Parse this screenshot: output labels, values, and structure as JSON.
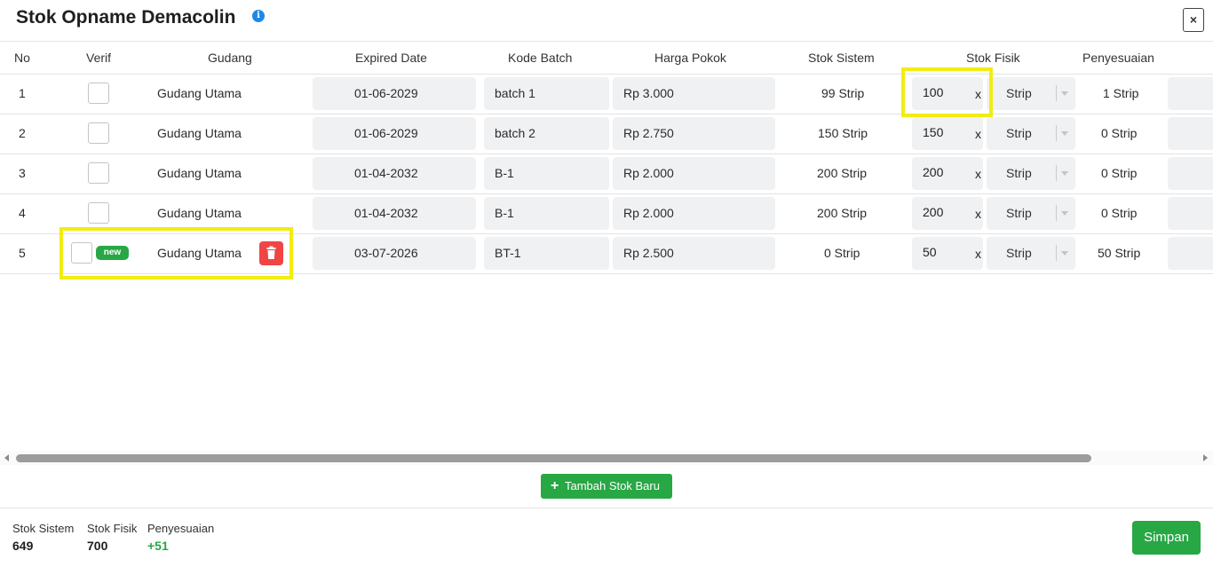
{
  "modal": {
    "title": "Stok Opname Demacolin",
    "info_icon": "info-icon",
    "close_label": "×"
  },
  "table": {
    "headers": {
      "no": "No",
      "verif": "Verif",
      "gudang": "Gudang",
      "expired": "Expired Date",
      "batch": "Kode Batch",
      "harga": "Harga Pokok",
      "sistem": "Stok Sistem",
      "fisik": "Stok Fisik",
      "penyesuaian": "Penyesuaian"
    },
    "rows": [
      {
        "no": "1",
        "gudang": "Gudang Utama",
        "expired": "01-06-2029",
        "batch": "batch 1",
        "harga": "Rp 3.000",
        "sistem": "99 Strip",
        "fisik": "100",
        "x": "x",
        "unit": "Strip",
        "penyesuaian": "1 Strip"
      },
      {
        "no": "2",
        "gudang": "Gudang Utama",
        "expired": "01-06-2029",
        "batch": "batch 2",
        "harga": "Rp 2.750",
        "sistem": "150 Strip",
        "fisik": "150",
        "x": "x",
        "unit": "Strip",
        "penyesuaian": "0 Strip"
      },
      {
        "no": "3",
        "gudang": "Gudang Utama",
        "expired": "01-04-2032",
        "batch": "B-1",
        "harga": "Rp 2.000",
        "sistem": "200 Strip",
        "fisik": "200",
        "x": "x",
        "unit": "Strip",
        "penyesuaian": "0 Strip"
      },
      {
        "no": "4",
        "gudang": "Gudang Utama",
        "expired": "01-04-2032",
        "batch": "B-1",
        "harga": "Rp 2.000",
        "sistem": "200 Strip",
        "fisik": "200",
        "x": "x",
        "unit": "Strip",
        "penyesuaian": "0 Strip"
      },
      {
        "no": "5",
        "gudang": "Gudang Utama",
        "expired": "03-07-2026",
        "batch": "BT-1",
        "harga": "Rp 2.500",
        "sistem": "0 Strip",
        "fisik": "50",
        "x": "x",
        "unit": "Strip",
        "penyesuaian": "50 Strip",
        "badge": "new"
      }
    ]
  },
  "actions": {
    "add_label": "Tambah Stok Baru",
    "save_label": "Simpan"
  },
  "summary": {
    "sistem_label": "Stok Sistem",
    "sistem_value": "649",
    "fisik_label": "Stok Fisik",
    "fisik_value": "700",
    "penyesuaian_label": "Penyesuaian",
    "penyesuaian_value": "+51"
  },
  "colors": {
    "accent_green": "#28a745",
    "delete_red": "#f04545",
    "highlight_yellow": "#f2ec12",
    "info_blue": "#1e88e5"
  }
}
